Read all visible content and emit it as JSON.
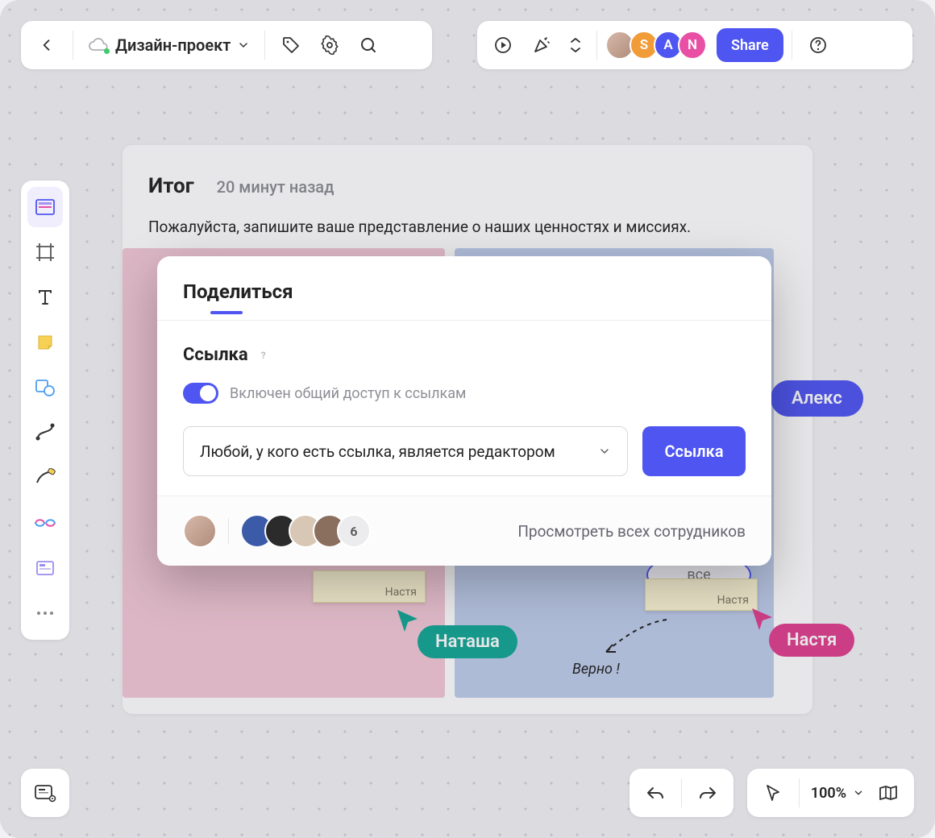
{
  "header": {
    "project_name": "Дизайн-проект",
    "share_label": "Share",
    "avatars": [
      {
        "letter": "",
        "bg": "#C9A9A0"
      },
      {
        "letter": "S",
        "bg": "#F29C38"
      },
      {
        "letter": "A",
        "bg": "#4E55F1"
      },
      {
        "letter": "N",
        "bg": "#E84FA5"
      }
    ]
  },
  "frame": {
    "title": "Итог",
    "timestamp": "20 минут назад",
    "subtitle": "Пожалуйста, запишите ваше представление о наших ценностях и миссиях.",
    "sticky1_author": "Настя",
    "sticky2_author": "Настя",
    "circle_text": "все",
    "note_text": "Верно !"
  },
  "cursors": {
    "alex": {
      "label": "Алекс",
      "bg": "#4E55F1"
    },
    "natasha": {
      "label": "Наташа",
      "bg": "#12A594"
    },
    "nastya": {
      "label": "Настя",
      "bg": "#E03E8C"
    }
  },
  "modal": {
    "title": "Поделиться",
    "section_title": "Ссылка",
    "toggle_label": "Включен общий доступ к ссылкам",
    "select_value": "Любой, у кого есть ссылка, является редактором",
    "link_button": "Ссылка",
    "footer_more_count": "6",
    "footer_link": "Просмотреть всех сотрудников"
  },
  "zoom": {
    "value": "100%"
  }
}
